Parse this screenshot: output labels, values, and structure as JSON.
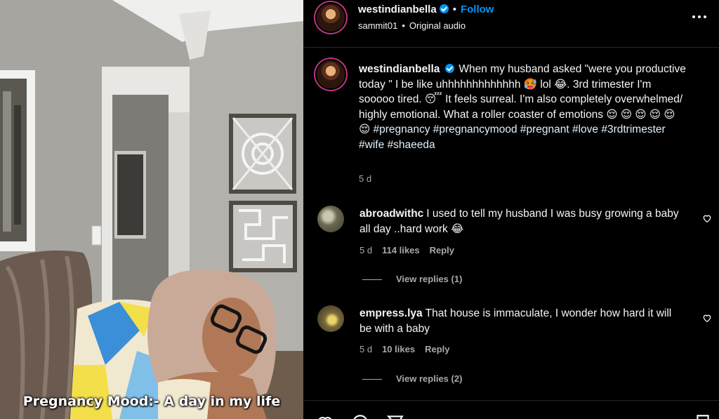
{
  "media": {
    "overlay_text": "Pregnancy Mood:- A day in my life"
  },
  "header": {
    "username": "westindianbella",
    "follow_label": "Follow",
    "sub_user": "sammit01",
    "audio_label": "Original audio"
  },
  "post": {
    "username": "westindianbella",
    "caption": "When my husband asked \"were you productive today \" I be like uhhhhhhhhhhhhh 🥵 lol 😂. 3rd trimester I'm sooooo tired. 😴 It feels surreal. I'm also completely overwhelmed/ highly emotional. What a roller coaster of emotions 😌 😌 😌 😌 😌 😌",
    "hashtags": "#pregnancy #pregnancymood #pregnant #love #3rdtrimester #wife #shaeeda",
    "time": "5 d"
  },
  "comments": [
    {
      "username": "abroadwithc",
      "text": "I used to tell my husband I was busy growing a baby all day ..hard work 😂",
      "time": "5 d",
      "likes": "114 likes",
      "reply_label": "Reply",
      "view_replies": "View replies (1)"
    },
    {
      "username": "empress.lya",
      "text": "That house is immaculate, I wonder how hard it will be with a baby",
      "time": "5 d",
      "likes": "10 likes",
      "reply_label": "Reply",
      "view_replies": "View replies (2)"
    }
  ],
  "icons": {
    "verified": "verified-badge-icon",
    "more": "more-options-icon",
    "heart": "heart-outline-icon",
    "comment": "comment-icon",
    "share": "share-icon",
    "save": "bookmark-icon"
  },
  "colors": {
    "background": "#000000",
    "link": "#0095f6",
    "hashtag": "#e0f1ff",
    "muted": "#a8a8a8"
  }
}
